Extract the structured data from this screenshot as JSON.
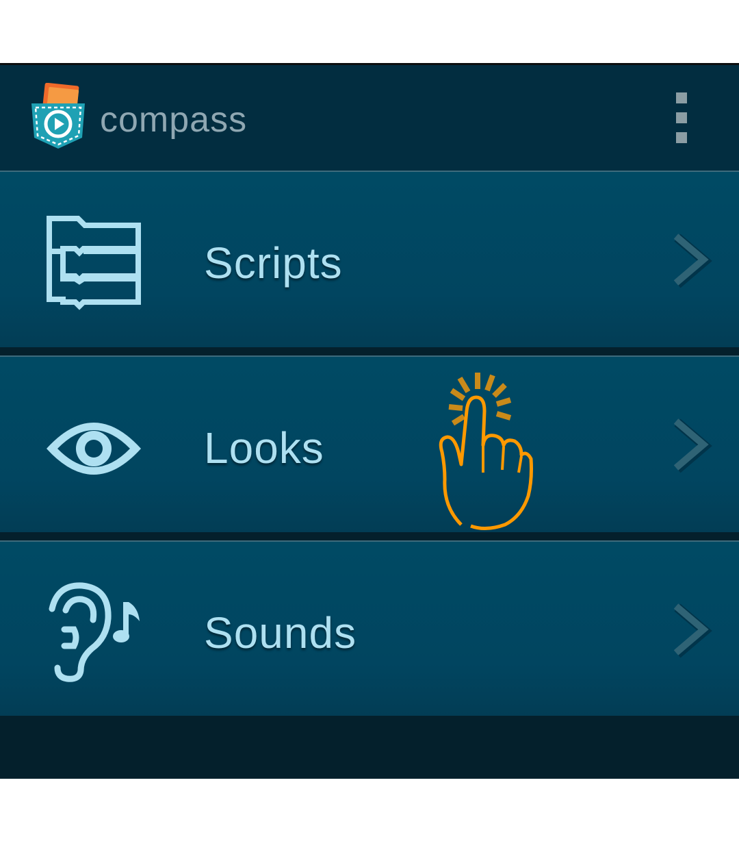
{
  "app": {
    "title": "compass",
    "logo_icon": "pocket-code-logo-icon",
    "menu_icon": "overflow-menu-icon"
  },
  "menu": {
    "items": [
      {
        "label": "Scripts",
        "icon": "scripts-icon"
      },
      {
        "label": "Looks",
        "icon": "eye-icon"
      },
      {
        "label": "Sounds",
        "icon": "ear-music-icon"
      }
    ]
  },
  "overlay": {
    "icon": "tap-gesture-hand-icon"
  },
  "colors": {
    "action_bar": "#022d40",
    "item_background": "#004a64",
    "item_text": "#aee0f1",
    "tap_hand": "#ff9900"
  }
}
